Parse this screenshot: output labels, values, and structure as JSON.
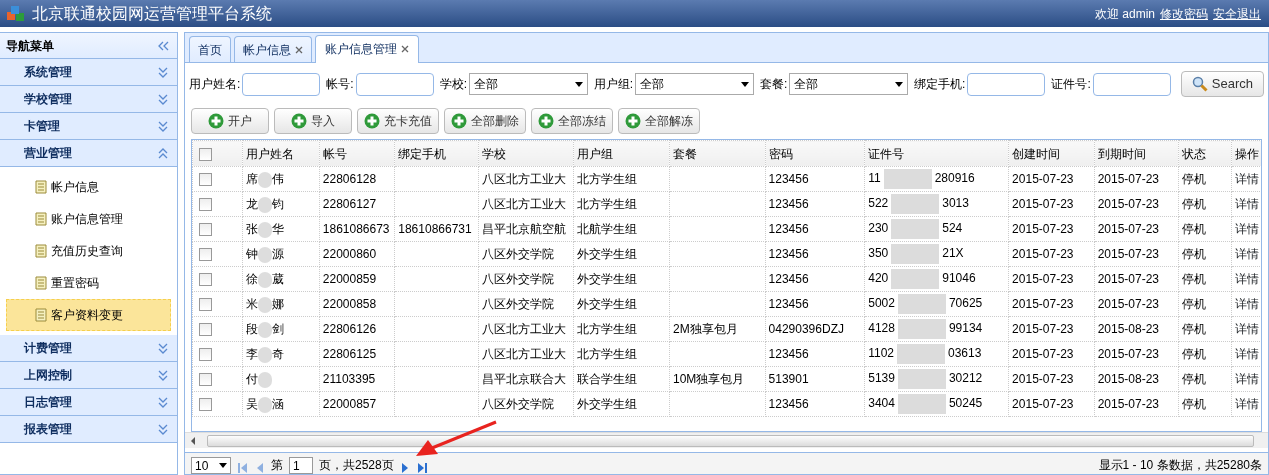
{
  "header": {
    "title": "北京联通校园网运营管理平台系统",
    "welcome": "欢迎 admin",
    "links": [
      "修改密码",
      "安全退出"
    ]
  },
  "sidebar": {
    "title": "导航菜单",
    "groups": [
      {
        "label": "系统管理",
        "expanded": false
      },
      {
        "label": "学校管理",
        "expanded": false
      },
      {
        "label": "卡管理",
        "expanded": false
      },
      {
        "label": "营业管理",
        "expanded": true,
        "items": [
          {
            "label": "帐户信息",
            "selected": false
          },
          {
            "label": "账户信息管理",
            "selected": false
          },
          {
            "label": "充值历史查询",
            "selected": false
          },
          {
            "label": "重置密码",
            "selected": false
          },
          {
            "label": "客户资料变更",
            "selected": true
          }
        ]
      },
      {
        "label": "计费管理",
        "expanded": false
      },
      {
        "label": "上网控制",
        "expanded": false
      },
      {
        "label": "日志管理",
        "expanded": false
      },
      {
        "label": "报表管理",
        "expanded": false
      }
    ]
  },
  "tabs": [
    {
      "label": "首页",
      "selected": false,
      "closable": false
    },
    {
      "label": "帐户信息",
      "selected": false,
      "closable": true
    },
    {
      "label": "账户信息管理",
      "selected": true,
      "closable": true
    }
  ],
  "filters": [
    {
      "kind": "text",
      "label": "用户姓名:"
    },
    {
      "kind": "text",
      "label": "帐号:"
    },
    {
      "kind": "select",
      "label": "学校:",
      "value": "全部"
    },
    {
      "kind": "select",
      "label": "用户组:",
      "value": "全部"
    },
    {
      "kind": "select",
      "label": "套餐:",
      "value": "全部"
    },
    {
      "kind": "text",
      "label": "绑定手机:"
    },
    {
      "kind": "text",
      "label": "证件号:"
    }
  ],
  "search_button": "Search",
  "actions": [
    "开户",
    "导入",
    "充卡充值",
    "全部删除",
    "全部冻结",
    "全部解冻"
  ],
  "table": {
    "header_checked": false,
    "columns": [
      "用户姓名",
      "帐号",
      "绑定手机",
      "学校",
      "用户组",
      "套餐",
      "密码",
      "证件号",
      "创建时间",
      "到期时间",
      "状态",
      "操作"
    ],
    "rows": [
      {
        "checked": false,
        "name_start": "席",
        "name_end": "伟",
        "account": "22806128",
        "phone": "",
        "school": "八区北方工业大",
        "group": "北方学生组",
        "plan": "",
        "password": "123456",
        "id_start": "11",
        "id_end": "280916",
        "created": "2015-07-23",
        "expires": "2015-07-23",
        "status": "停机",
        "action": "详情"
      },
      {
        "checked": false,
        "name_start": "龙",
        "name_end": "钧",
        "account": "22806127",
        "phone": "",
        "school": "八区北方工业大",
        "group": "北方学生组",
        "plan": "",
        "password": "123456",
        "id_start": "522",
        "id_end": "3013",
        "created": "2015-07-23",
        "expires": "2015-07-23",
        "status": "停机",
        "action": "详情"
      },
      {
        "checked": false,
        "name_start": "张",
        "name_end": "华",
        "account": "1861086673",
        "phone": "18610866731",
        "school": "昌平北京航空航",
        "group": "北航学生组",
        "plan": "",
        "password": "123456",
        "id_start": "230",
        "id_end": "524",
        "created": "2015-07-23",
        "expires": "2015-07-23",
        "status": "停机",
        "action": "详情"
      },
      {
        "checked": false,
        "name_start": "钟",
        "name_end": "源",
        "account": "22000860",
        "phone": "",
        "school": "八区外交学院",
        "group": "外交学生组",
        "plan": "",
        "password": "123456",
        "id_start": "350",
        "id_end": "21X",
        "created": "2015-07-23",
        "expires": "2015-07-23",
        "status": "停机",
        "action": "详情"
      },
      {
        "checked": false,
        "name_start": "徐",
        "name_end": "葳",
        "account": "22000859",
        "phone": "",
        "school": "八区外交学院",
        "group": "外交学生组",
        "plan": "",
        "password": "123456",
        "id_start": "420",
        "id_end": "91046",
        "created": "2015-07-23",
        "expires": "2015-07-23",
        "status": "停机",
        "action": "详情"
      },
      {
        "checked": false,
        "name_start": "米",
        "name_end": "娜",
        "account": "22000858",
        "phone": "",
        "school": "八区外交学院",
        "group": "外交学生组",
        "plan": "",
        "password": "123456",
        "id_start": "5002",
        "id_end": "70625",
        "created": "2015-07-23",
        "expires": "2015-07-23",
        "status": "停机",
        "action": "详情"
      },
      {
        "checked": false,
        "name_start": "段",
        "name_end": "剑",
        "account": "22806126",
        "phone": "",
        "school": "八区北方工业大",
        "group": "北方学生组",
        "plan": "2M独享包月",
        "password": "04290396DZJ",
        "id_start": "4128",
        "id_end": "99134",
        "created": "2015-07-23",
        "expires": "2015-08-23",
        "status": "停机",
        "action": "详情"
      },
      {
        "checked": false,
        "name_start": "李",
        "name_end": "奇",
        "account": "22806125",
        "phone": "",
        "school": "八区北方工业大",
        "group": "北方学生组",
        "plan": "",
        "password": "123456",
        "id_start": "1102",
        "id_end": "03613",
        "created": "2015-07-23",
        "expires": "2015-07-23",
        "status": "停机",
        "action": "详情"
      },
      {
        "checked": false,
        "name_start": "付",
        "name_end": "",
        "account": "21103395",
        "phone": "",
        "school": "昌平北京联合大",
        "group": "联合学生组",
        "plan": "10M独享包月",
        "password": "513901",
        "id_start": "5139",
        "id_end": "30212",
        "created": "2015-07-23",
        "expires": "2015-08-23",
        "status": "停机",
        "action": "详情"
      },
      {
        "checked": false,
        "name_start": "吴",
        "name_end": "涵",
        "account": "22000857",
        "phone": "",
        "school": "八区外交学院",
        "group": "外交学生组",
        "plan": "",
        "password": "123456",
        "id_start": "3404",
        "id_end": "50245",
        "created": "2015-07-23",
        "expires": "2015-07-23",
        "status": "停机",
        "action": "详情"
      }
    ]
  },
  "pager": {
    "page_size": "10",
    "page_prefix": "第",
    "page": "1",
    "page_suffix": "页，共2528页",
    "summary": "显示1 - 10 条数据，共25280条"
  }
}
